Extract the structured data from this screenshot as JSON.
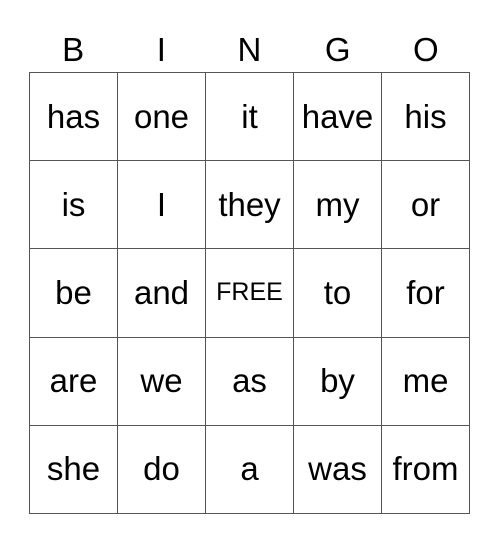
{
  "header": [
    "B",
    "I",
    "N",
    "G",
    "O"
  ],
  "free_label": "FREE",
  "rows": [
    [
      "has",
      "one",
      "it",
      "have",
      "his"
    ],
    [
      "is",
      "I",
      "they",
      "my",
      "or"
    ],
    [
      "be",
      "and",
      "FREE",
      "to",
      "for"
    ],
    [
      "are",
      "we",
      "as",
      "by",
      "me"
    ],
    [
      "she",
      "do",
      "a",
      "was",
      "from"
    ]
  ]
}
